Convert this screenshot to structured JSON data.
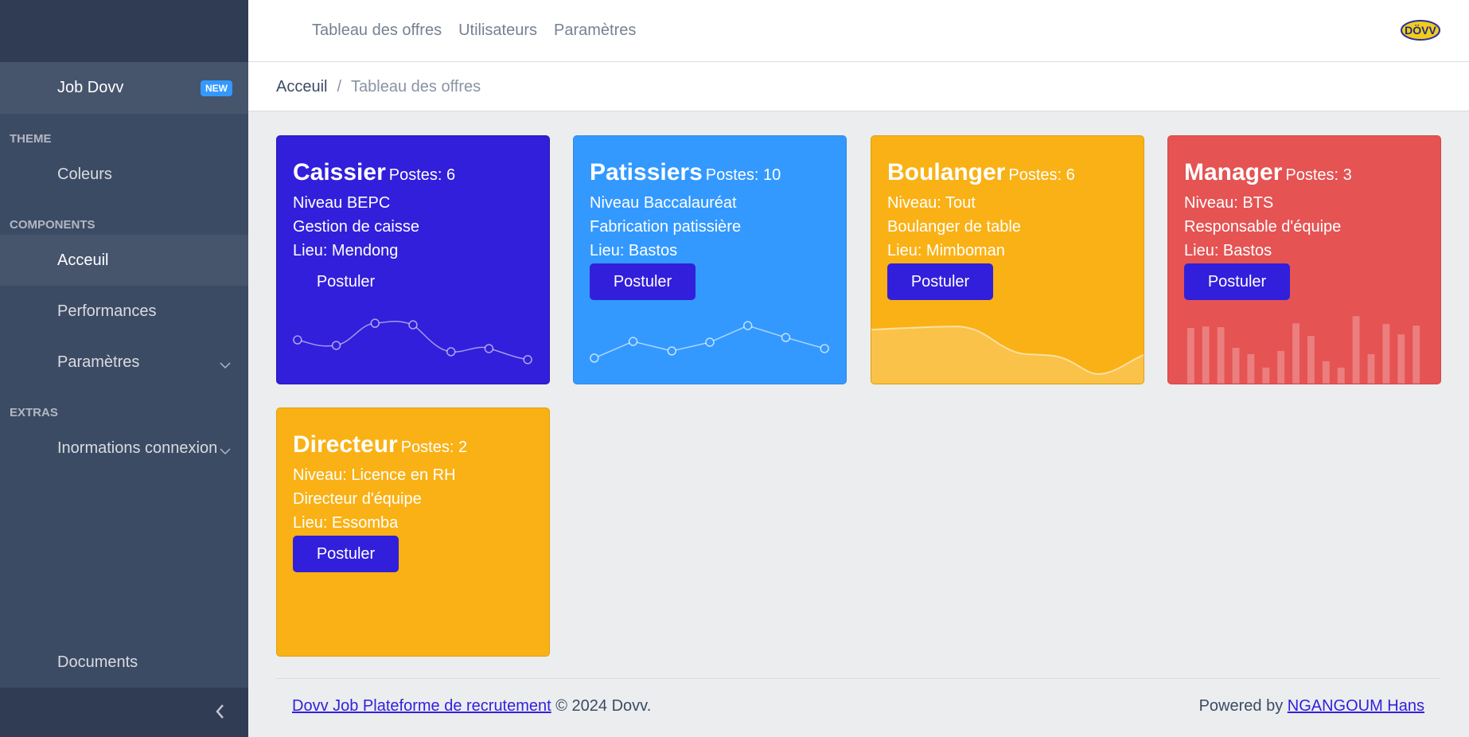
{
  "sidebar": {
    "top_item": {
      "label": "Job Dovv",
      "badge": "NEW"
    },
    "sections": [
      {
        "title": "THEME",
        "items": [
          {
            "label": "Coleurs"
          }
        ]
      },
      {
        "title": "COMPONENTS",
        "items": [
          {
            "label": "Acceuil"
          },
          {
            "label": "Performances"
          },
          {
            "label": "Paramètres"
          }
        ]
      },
      {
        "title": "EXTRAS",
        "items": [
          {
            "label": "Inormations connexion"
          }
        ]
      }
    ],
    "bottom_item": {
      "label": "Documents"
    }
  },
  "header": {
    "nav": [
      "Tableau des offres",
      "Utilisateurs",
      "Paramètres"
    ],
    "logo_text": "DÖVV"
  },
  "breadcrumb": {
    "home": "Acceuil",
    "separator": "/",
    "current": "Tableau des offres"
  },
  "offers": [
    {
      "title": "Caissier",
      "postes": "Postes: 6",
      "niveau": "Niveau BEPC",
      "description": "Gestion de caisse",
      "lieu": "Lieu: Mendong",
      "button": "Postuler",
      "color": "#321fdb"
    },
    {
      "title": "Patissiers",
      "postes": "Postes: 10",
      "niveau": "Niveau Baccalauréat",
      "description": "Fabrication patissière",
      "lieu": "Lieu: Bastos",
      "button": "Postuler",
      "color": "#3399ff"
    },
    {
      "title": "Boulanger",
      "postes": "Postes: 6",
      "niveau": "Niveau: Tout",
      "description": "Boulanger de table",
      "lieu": "Lieu: Mimboman",
      "button": "Postuler",
      "color": "#f9b115"
    },
    {
      "title": "Manager",
      "postes": "Postes: 3",
      "niveau": "Niveau: BTS",
      "description": "Responsable d'équipe",
      "lieu": "Lieu: Bastos",
      "button": "Postuler",
      "color": "#e55353"
    },
    {
      "title": "Directeur",
      "postes": "Postes: 2",
      "niveau": "Niveau: Licence en RH",
      "description": "Directeur d'équipe",
      "lieu": "Lieu: Essomba",
      "button": "Postuler",
      "color": "#f9b115"
    }
  ],
  "footer": {
    "link": "Dovv Job Plateforme de recrutement",
    "copyright": "© 2024 Dovv.",
    "powered_prefix": "Powered by",
    "powered_link": "NGANGOUM Hans"
  }
}
